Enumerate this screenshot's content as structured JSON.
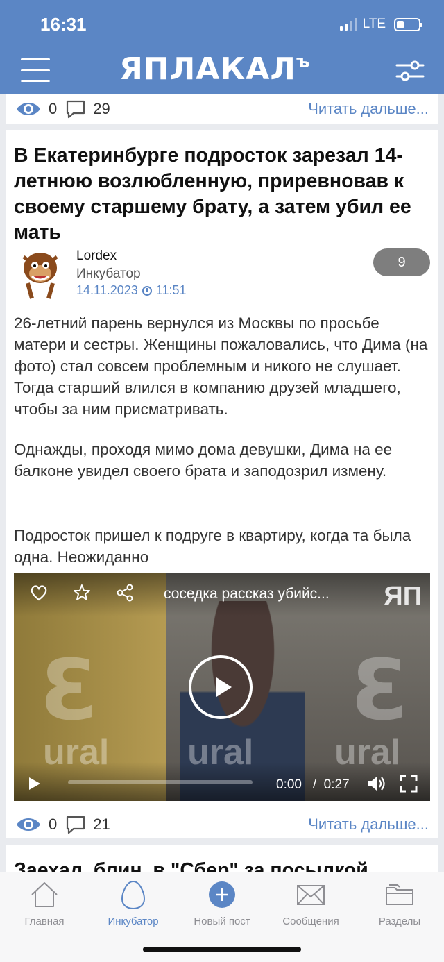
{
  "status_bar": {
    "time": "16:31",
    "network": "LTE"
  },
  "header": {
    "logo": "ЯПЛАКАЛ",
    "logo_sign": "ъ"
  },
  "post_prev": {
    "views": "0",
    "comments": "29",
    "read_more": "Читать дальше..."
  },
  "post": {
    "title": "В Екатеринбурге подросток зарезал 14-летнюю возлюбленную, приревновав к своему старшему брату, а затем убил ее мать",
    "author": "Lordex",
    "section": "Инкубатор",
    "date": "14.11.2023",
    "time": "11:51",
    "rating": "9",
    "paragraphs": [
      "26-летний парень вернулся из Москвы по просьбе матери и сестры. Женщины пожаловались, что Дима (на фото) стал совсем проблемным и никого не слушает. Тогда старший влился в компанию друзей младшего, чтобы за ним присматривать.",
      "Однажды, проходя мимо дома девушки, Дима на ее балконе увидел своего брата и заподозрил измену.",
      "Подросток пришел к подруге в квартиру, когда та была одна. Неожиданно"
    ],
    "video": {
      "title": "соседка рассказ убийс...",
      "logo": "ЯП",
      "watermark_text": "ural",
      "current_time": "0:00",
      "separator": "/",
      "duration": "0:27",
      "progress": 0
    },
    "views": "0",
    "comments": "21",
    "read_more": "Читать дальше..."
  },
  "next_post": {
    "title": "Заехал, блин, в \"Сбер\" за посылкой"
  },
  "tabbar": {
    "tabs": [
      {
        "label": "Главная",
        "icon": "home-icon"
      },
      {
        "label": "Инкубатор",
        "icon": "egg-icon",
        "active": true
      },
      {
        "label": "Новый пост",
        "icon": "plus-circle-icon"
      },
      {
        "label": "Сообщения",
        "icon": "envelope-icon"
      },
      {
        "label": "Разделы",
        "icon": "folders-icon"
      }
    ]
  },
  "colors": {
    "accent": "#5b86c5",
    "header": "#5b86c5",
    "rating_bg": "#7e7e7e"
  }
}
